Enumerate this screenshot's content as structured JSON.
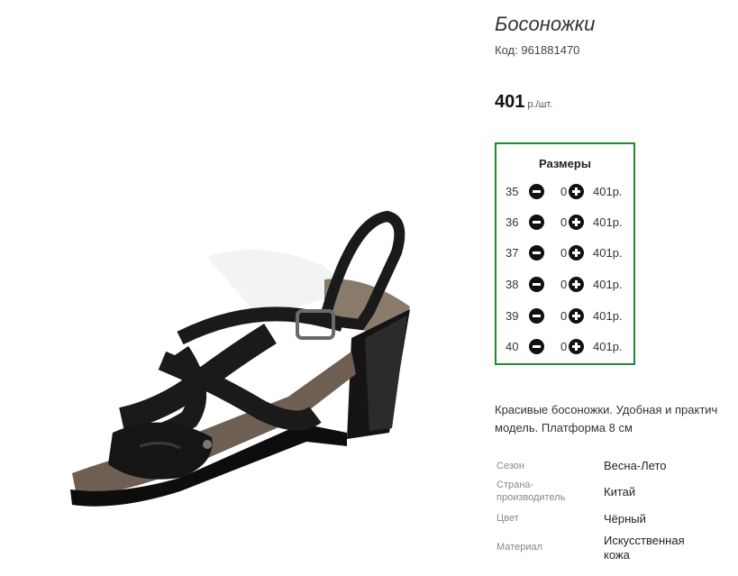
{
  "product": {
    "title": "Босоножки",
    "code_label": "Код:",
    "code_value": "961881470",
    "price_value": "401",
    "price_unit": "р./шт.",
    "image_alt": "black-wedge-sandal"
  },
  "sizes": {
    "title": "Размеры",
    "rows": [
      {
        "size": "35",
        "qty": "0",
        "price": "401р."
      },
      {
        "size": "36",
        "qty": "0",
        "price": "401р."
      },
      {
        "size": "37",
        "qty": "0",
        "price": "401р."
      },
      {
        "size": "38",
        "qty": "0",
        "price": "401р."
      },
      {
        "size": "39",
        "qty": "0",
        "price": "401р."
      },
      {
        "size": "40",
        "qty": "0",
        "price": "401р."
      }
    ]
  },
  "description": {
    "line1": "Красивые босоножки. Удобная и практич",
    "line2": "модель. Платформа 8 см"
  },
  "specs": [
    {
      "label1": "Сезон",
      "label2": "",
      "value1": "Весна-Лето",
      "value2": ""
    },
    {
      "label1": "Страна-",
      "label2": "производитель",
      "value1": "Китай",
      "value2": ""
    },
    {
      "label1": "Цвет",
      "label2": "",
      "value1": "Чёрный",
      "value2": ""
    },
    {
      "label1": "Материал",
      "label2": "",
      "value1": "Искусственная",
      "value2": "кожа"
    }
  ],
  "colors": {
    "sizes_border": "#1f8a2a",
    "sandal": "#1a1a1a",
    "lining": "#8a7a6a"
  },
  "icons": {
    "minus": "minus-circle-icon",
    "plus": "plus-circle-icon"
  }
}
